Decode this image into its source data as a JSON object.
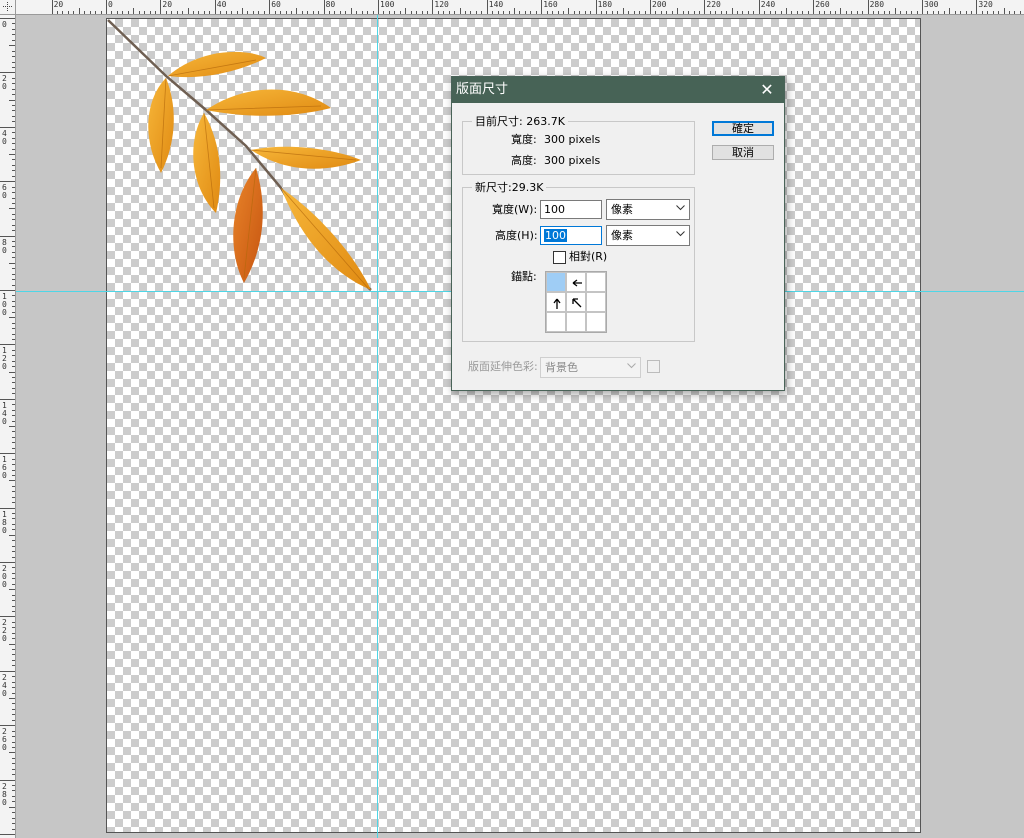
{
  "ruler": {
    "top_labels": [
      "20",
      "0",
      "20",
      "40",
      "60",
      "80",
      "100",
      "120",
      "140",
      "160",
      "180",
      "200",
      "220",
      "240",
      "260",
      "280",
      "300",
      "320"
    ],
    "left_labels": [
      "0",
      "20",
      "40",
      "60",
      "80",
      "100",
      "120",
      "140",
      "160",
      "180",
      "200",
      "220",
      "240",
      "260",
      "280"
    ]
  },
  "dialog": {
    "title": "版面尺寸",
    "close_symbol": "✕",
    "current": {
      "group_label": "目前尺寸: 263.7K",
      "width_label": "寬度:",
      "width_value": "300 pixels",
      "height_label": "高度:",
      "height_value": "300 pixels"
    },
    "new": {
      "group_label": "新尺寸:29.3K",
      "width_label": "寬度(W):",
      "width_value": "100",
      "width_unit": "像素",
      "height_label": "高度(H):",
      "height_value": "100",
      "height_unit": "像素",
      "relative_label": "相對(R)",
      "relative_checked": false,
      "anchor_label": "錨點:"
    },
    "extension_color_label": "版面延伸色彩:",
    "extension_color_value": "背景色",
    "ok_label": "確定",
    "cancel_label": "取消"
  },
  "colors": {
    "title_bar": "#476356",
    "guide": "#4fd6e6",
    "anchor_active": "#9fcdf5",
    "leaf_orange": "#f0a020"
  },
  "icons": {
    "close": "close-icon",
    "dropdown": "chevron-down-icon",
    "anchor_arrows": [
      "arrow-left-icon",
      "arrow-up-icon",
      "arrow-up-left-icon"
    ]
  }
}
